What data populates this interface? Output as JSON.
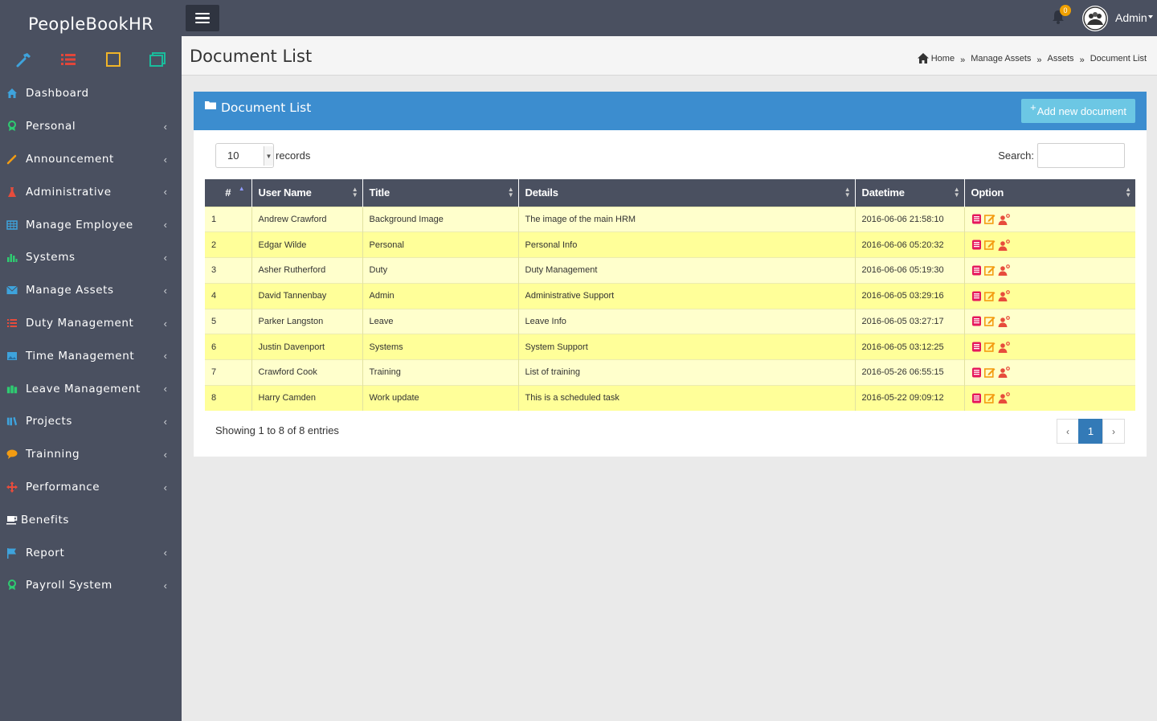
{
  "app": {
    "brand": "PeopleBookHR"
  },
  "colors": {
    "sidebar": "#4a5060",
    "box_header": "#3c8dcf",
    "add_button": "#6cc7e4",
    "row_odd": "#ffffcc",
    "row_even": "#ffff99",
    "badge": "#f0a000"
  },
  "quick_icons": [
    "hammer-icon",
    "list-icon",
    "square-icon",
    "window-icon"
  ],
  "sidebar": {
    "items": [
      {
        "label": "Dashboard",
        "icon": "home-icon",
        "chevron": false
      },
      {
        "label": "Personal",
        "icon": "award-icon",
        "chevron": true
      },
      {
        "label": "Announcement",
        "icon": "pencil-icon",
        "chevron": true
      },
      {
        "label": "Administrative",
        "icon": "flask-icon",
        "chevron": true
      },
      {
        "label": "Manage Employee",
        "icon": "grid-icon",
        "chevron": true
      },
      {
        "label": "Systems",
        "icon": "bar-chart-icon",
        "chevron": true
      },
      {
        "label": "Manage Assets",
        "icon": "envelope-icon",
        "chevron": true
      },
      {
        "label": "Duty Management",
        "icon": "list-icon",
        "chevron": true
      },
      {
        "label": "Time Management",
        "icon": "picture-icon",
        "chevron": true
      },
      {
        "label": "Leave Management",
        "icon": "group-icon",
        "chevron": true
      },
      {
        "label": "Projects",
        "icon": "book-icon",
        "chevron": true
      },
      {
        "label": "Trainning",
        "icon": "comment-icon",
        "chevron": true
      },
      {
        "label": "Performance",
        "icon": "move-icon",
        "chevron": true
      },
      {
        "label": "Benefits",
        "icon": "coffee-icon",
        "chevron": false
      },
      {
        "label": "Report",
        "icon": "flag-icon",
        "chevron": true
      },
      {
        "label": "Payroll System",
        "icon": "award-icon",
        "chevron": true
      }
    ]
  },
  "topbar": {
    "notification_count": "0",
    "user": "Admin"
  },
  "page": {
    "title": "Document List",
    "breadcrumb": [
      "Home",
      "Manage Assets",
      "Assets",
      "Document List"
    ]
  },
  "box": {
    "title": "Document List",
    "add_button": "Add new document",
    "length_value": "10",
    "length_suffix": "records",
    "search_label": "Search:",
    "search_value": "",
    "columns": [
      "#",
      "User Name",
      "Title",
      "Details",
      "Datetime",
      "Option"
    ],
    "rows": [
      {
        "n": "1",
        "user": "Andrew Crawford",
        "title": "Background Image",
        "details": "The image of the main HRM",
        "datetime": "2016-06-06 21:58:10"
      },
      {
        "n": "2",
        "user": "Edgar Wilde",
        "title": "Personal",
        "details": "Personal Info",
        "datetime": "2016-06-06 05:20:32"
      },
      {
        "n": "3",
        "user": "Asher Rutherford",
        "title": "Duty",
        "details": "Duty Management",
        "datetime": "2016-06-06 05:19:30"
      },
      {
        "n": "4",
        "user": "David Tannenbay",
        "title": "Admin",
        "details": "Administrative Support",
        "datetime": "2016-06-05 03:29:16"
      },
      {
        "n": "5",
        "user": "Parker Langston",
        "title": "Leave",
        "details": "Leave Info",
        "datetime": "2016-06-05 03:27:17"
      },
      {
        "n": "6",
        "user": "Justin Davenport",
        "title": "Systems",
        "details": "System Support",
        "datetime": "2016-06-05 03:12:25"
      },
      {
        "n": "7",
        "user": "Crawford Cook",
        "title": "Training",
        "details": "List of training",
        "datetime": "2016-05-26 06:55:15"
      },
      {
        "n": "8",
        "user": "Harry Camden",
        "title": "Work update",
        "details": "This is a scheduled task",
        "datetime": "2016-05-22 09:09:12"
      }
    ],
    "info": "Showing 1 to 8 of 8 entries",
    "page_current": "1"
  }
}
